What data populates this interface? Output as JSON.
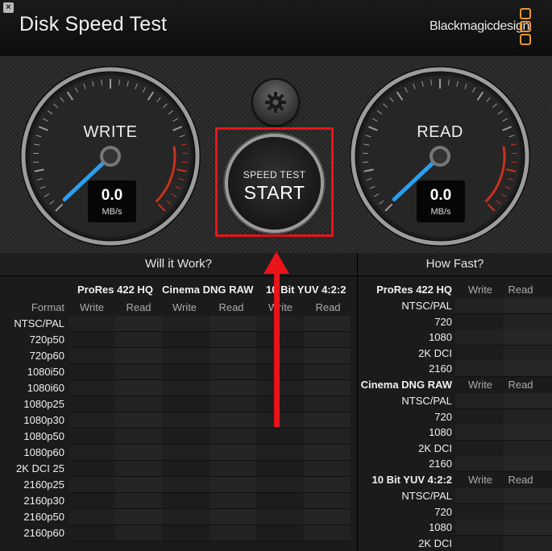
{
  "app": {
    "title": "Disk Speed Test",
    "brand": "Blackmagicdesign",
    "close_glyph": "×"
  },
  "gauges": {
    "write": {
      "label": "WRITE",
      "value": "0.0",
      "unit": "MB/s"
    },
    "read": {
      "label": "READ",
      "value": "0.0",
      "unit": "MB/s"
    }
  },
  "start_button": {
    "small": "SPEED TEST",
    "big": "START"
  },
  "icons": {
    "settings": "gear-icon",
    "close": "close-icon",
    "logo": "blackmagic-logo-icon"
  },
  "colors": {
    "accent": "#e8962f",
    "needle": "#2a9ff0",
    "highlight": "#e8141a",
    "redline": "#c8321e"
  },
  "will_it_work": {
    "heading": "Will it Work?",
    "format_label": "Format",
    "columns": [
      {
        "name": "ProRes 422 HQ",
        "write": "Write",
        "read": "Read"
      },
      {
        "name": "Cinema DNG RAW",
        "write": "Write",
        "read": "Read"
      },
      {
        "name": "10 Bit YUV 4:2:2",
        "write": "Write",
        "read": "Read"
      }
    ],
    "rows": [
      "NTSC/PAL",
      "720p50",
      "720p60",
      "1080i50",
      "1080i60",
      "1080p25",
      "1080p30",
      "1080p50",
      "1080p60",
      "2K DCI 25",
      "2160p25",
      "2160p30",
      "2160p50",
      "2160p60"
    ]
  },
  "how_fast": {
    "heading": "How Fast?",
    "groups": [
      {
        "name": "ProRes 422 HQ",
        "write": "Write",
        "read": "Read",
        "rows": [
          "NTSC/PAL",
          "720",
          "1080",
          "2K DCI",
          "2160"
        ]
      },
      {
        "name": "Cinema DNG RAW",
        "write": "Write",
        "read": "Read",
        "rows": [
          "NTSC/PAL",
          "720",
          "1080",
          "2K DCI",
          "2160"
        ]
      },
      {
        "name": "10 Bit YUV 4:2:2",
        "write": "Write",
        "read": "Read",
        "rows": [
          "NTSC/PAL",
          "720",
          "1080",
          "2K DCI"
        ]
      }
    ]
  }
}
